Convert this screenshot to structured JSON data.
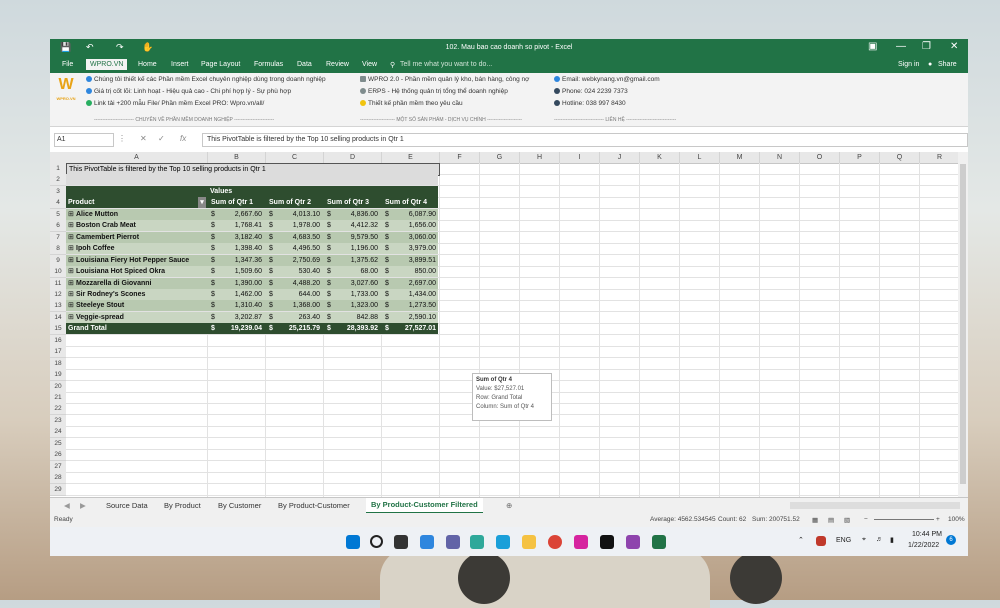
{
  "title": "102. Mau bao cao doanh so pivot - Excel",
  "account": {
    "sign_in": "Sign in",
    "share": "Share"
  },
  "menu_tabs": [
    "File",
    "WPRO.VN",
    "Home",
    "Insert",
    "Page Layout",
    "Formulas",
    "Data",
    "Review",
    "View"
  ],
  "tell_me": "Tell me what you want to do...",
  "ribbon": {
    "logo": "W",
    "logo_sub": "WPRO.VN",
    "col1": [
      "Chúng tôi thiết kế các Phần mềm Excel chuyên nghiệp dùng trong doanh nghiệp",
      "Giá trị cốt lõi: Linh hoạt - Hiệu quả cao - Chi phí hợp lý - Sự phù hợp",
      "Link tải +200 mẫu File/ Phần mềm Excel PRO: Wpro.vn/all/"
    ],
    "col1_group": "------------------------ CHUYÊN VỀ PHẦN MỀM DOANH NGHIỆP ------------------------",
    "col2": [
      "WPRO 2.0 - Phần mềm quản lý kho, bán hàng, công nợ",
      "ERPS - Hệ thống quản trị tổng thể doanh nghiệp",
      "Thiết kế phần mềm theo yêu cầu"
    ],
    "col2_group": "--------------------- MỘT SỐ SẢN PHẨM - DỊCH VỤ CHÍNH ---------------------",
    "col3": [
      "Email: webkynang.vn@gmail.com",
      "Phone: 024 2239 7373",
      "Hotline: 038 997 8430"
    ],
    "col3_group": "------------------------------ LIÊN HỆ ------------------------------",
    "colors": {
      "dot1": "#2e86de",
      "dot2": "#27ae60",
      "dot3": "#8e44ad"
    }
  },
  "formula_bar": {
    "name_box": "A1",
    "fx": "fx",
    "formula": "This PivotTable is filtered by the Top 10 selling products in Qtr 1"
  },
  "columns": [
    "A",
    "B",
    "C",
    "D",
    "E",
    "F",
    "G",
    "H",
    "I",
    "J",
    "K",
    "L",
    "M",
    "N",
    "O",
    "P",
    "Q",
    "R"
  ],
  "row_numbers": [
    "1",
    "2",
    "3",
    "4",
    "5",
    "6",
    "7",
    "8",
    "9",
    "10",
    "11",
    "12",
    "13",
    "14",
    "15",
    "16",
    "17",
    "18",
    "19",
    "20",
    "21",
    "22",
    "23",
    "24",
    "25",
    "26",
    "27",
    "28",
    "29"
  ],
  "pivot": {
    "note": "This PivotTable is filtered by the Top 10 selling products in Qtr 1",
    "values_label": "Values",
    "product_label": "Product",
    "headers": [
      "Sum of Qtr 1",
      "Sum of Qtr 2",
      "Sum of Qtr 3",
      "Sum of Qtr 4"
    ],
    "currency": "$",
    "rows": [
      {
        "name": "Alice Mutton",
        "v": [
          "2,667.60",
          "4,013.10",
          "4,836.00",
          "6,087.90"
        ]
      },
      {
        "name": "Boston Crab Meat",
        "v": [
          "1,768.41",
          "1,978.00",
          "4,412.32",
          "1,656.00"
        ]
      },
      {
        "name": "Camembert Pierrot",
        "v": [
          "3,182.40",
          "4,683.50",
          "9,579.50",
          "3,060.00"
        ]
      },
      {
        "name": "Ipoh Coffee",
        "v": [
          "1,398.40",
          "4,496.50",
          "1,196.00",
          "3,979.00"
        ]
      },
      {
        "name": "Louisiana Fiery Hot Pepper Sauce",
        "v": [
          "1,347.36",
          "2,750.69",
          "1,375.62",
          "3,899.51"
        ]
      },
      {
        "name": "Louisiana Hot Spiced Okra",
        "v": [
          "1,509.60",
          "530.40",
          "68.00",
          "850.00"
        ]
      },
      {
        "name": "Mozzarella di Giovanni",
        "v": [
          "1,390.00",
          "4,488.20",
          "3,027.60",
          "2,697.00"
        ]
      },
      {
        "name": "Sir Rodney's Scones",
        "v": [
          "1,462.00",
          "644.00",
          "1,733.00",
          "1,434.00"
        ]
      },
      {
        "name": "Steeleye Stout",
        "v": [
          "1,310.40",
          "1,368.00",
          "1,323.00",
          "1,273.50"
        ]
      },
      {
        "name": "Veggie-spread",
        "v": [
          "3,202.87",
          "263.40",
          "842.88",
          "2,590.10"
        ]
      }
    ],
    "total": {
      "name": "Grand Total",
      "v": [
        "19,239.04",
        "25,215.79",
        "28,393.92",
        "27,527.01"
      ]
    }
  },
  "tooltip": {
    "title": "Sum of Qtr 4",
    "value": "Value: $27,527.01",
    "row": "Row: Grand Total",
    "column": "Column: Sum of Qtr 4"
  },
  "sheet_tabs": [
    "Source Data",
    "By Product",
    "By Customer",
    "By Product-Customer",
    "By Product-Customer Filtered"
  ],
  "status": {
    "ready": "Ready",
    "average": "Average: 4562.534545",
    "count": "Count: 62",
    "sum": "Sum: 200751.52",
    "zoom": "100%"
  },
  "taskbar": {
    "lang": "ENG",
    "time": "10:44 PM",
    "date": "1/22/2022",
    "badge": "6"
  }
}
